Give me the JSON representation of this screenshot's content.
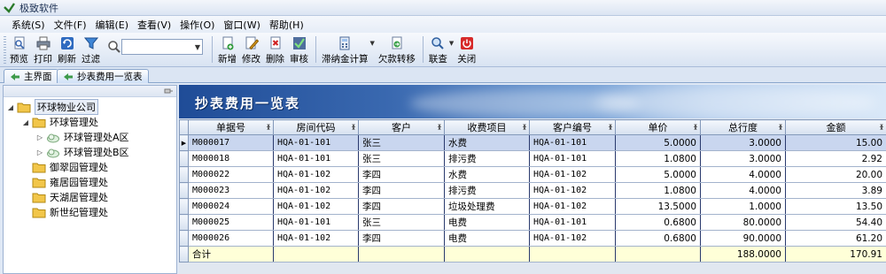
{
  "window": {
    "title": "极致软件"
  },
  "menu": [
    "系统(S)",
    "文件(F)",
    "编辑(E)",
    "查看(V)",
    "操作(O)",
    "窗口(W)",
    "帮助(H)"
  ],
  "toolbar": {
    "group1": [
      "预览",
      "打印",
      "刷新",
      "过滤"
    ],
    "search_value": "",
    "group2": [
      "新增",
      "修改",
      "删除",
      "审核"
    ],
    "group3": [
      "滞纳金计算",
      "欠款转移"
    ],
    "group4": [
      "联查",
      "关闭"
    ]
  },
  "tabs": [
    "主界面",
    "抄表费用一览表"
  ],
  "tree": {
    "root": "环球物业公司",
    "level1": "环球管理处",
    "level2": [
      "环球管理处A区",
      "环球管理处B区"
    ],
    "others": [
      "御翠园管理处",
      "雍居园管理处",
      "天湖居管理处",
      "新世纪管理处"
    ]
  },
  "banner_title": "抄表费用一览表",
  "table": {
    "columns": [
      "单据号",
      "房间代码",
      "客户",
      "收费项目",
      "客户编号",
      "单价",
      "总行度",
      "金额"
    ],
    "rows": [
      [
        "M000017",
        "HQA-01-101",
        "张三",
        "水费",
        "HQA-01-101",
        "5.0000",
        "3.0000",
        "15.00"
      ],
      [
        "M000018",
        "HQA-01-101",
        "张三",
        "排污费",
        "HQA-01-101",
        "1.0800",
        "3.0000",
        "2.92"
      ],
      [
        "M000022",
        "HQA-01-102",
        "李四",
        "水费",
        "HQA-01-102",
        "5.0000",
        "4.0000",
        "20.00"
      ],
      [
        "M000023",
        "HQA-01-102",
        "李四",
        "排污费",
        "HQA-01-102",
        "1.0800",
        "4.0000",
        "3.89"
      ],
      [
        "M000024",
        "HQA-01-102",
        "李四",
        "垃圾处理费",
        "HQA-01-102",
        "13.5000",
        "1.0000",
        "13.50"
      ],
      [
        "M000025",
        "HQA-01-101",
        "张三",
        "电费",
        "HQA-01-101",
        "0.6800",
        "80.0000",
        "54.40"
      ],
      [
        "M000026",
        "HQA-01-102",
        "李四",
        "电费",
        "HQA-01-102",
        "0.6800",
        "90.0000",
        "61.20"
      ]
    ],
    "total": {
      "label": "合计",
      "qty": "188.0000",
      "amount": "170.91"
    }
  }
}
